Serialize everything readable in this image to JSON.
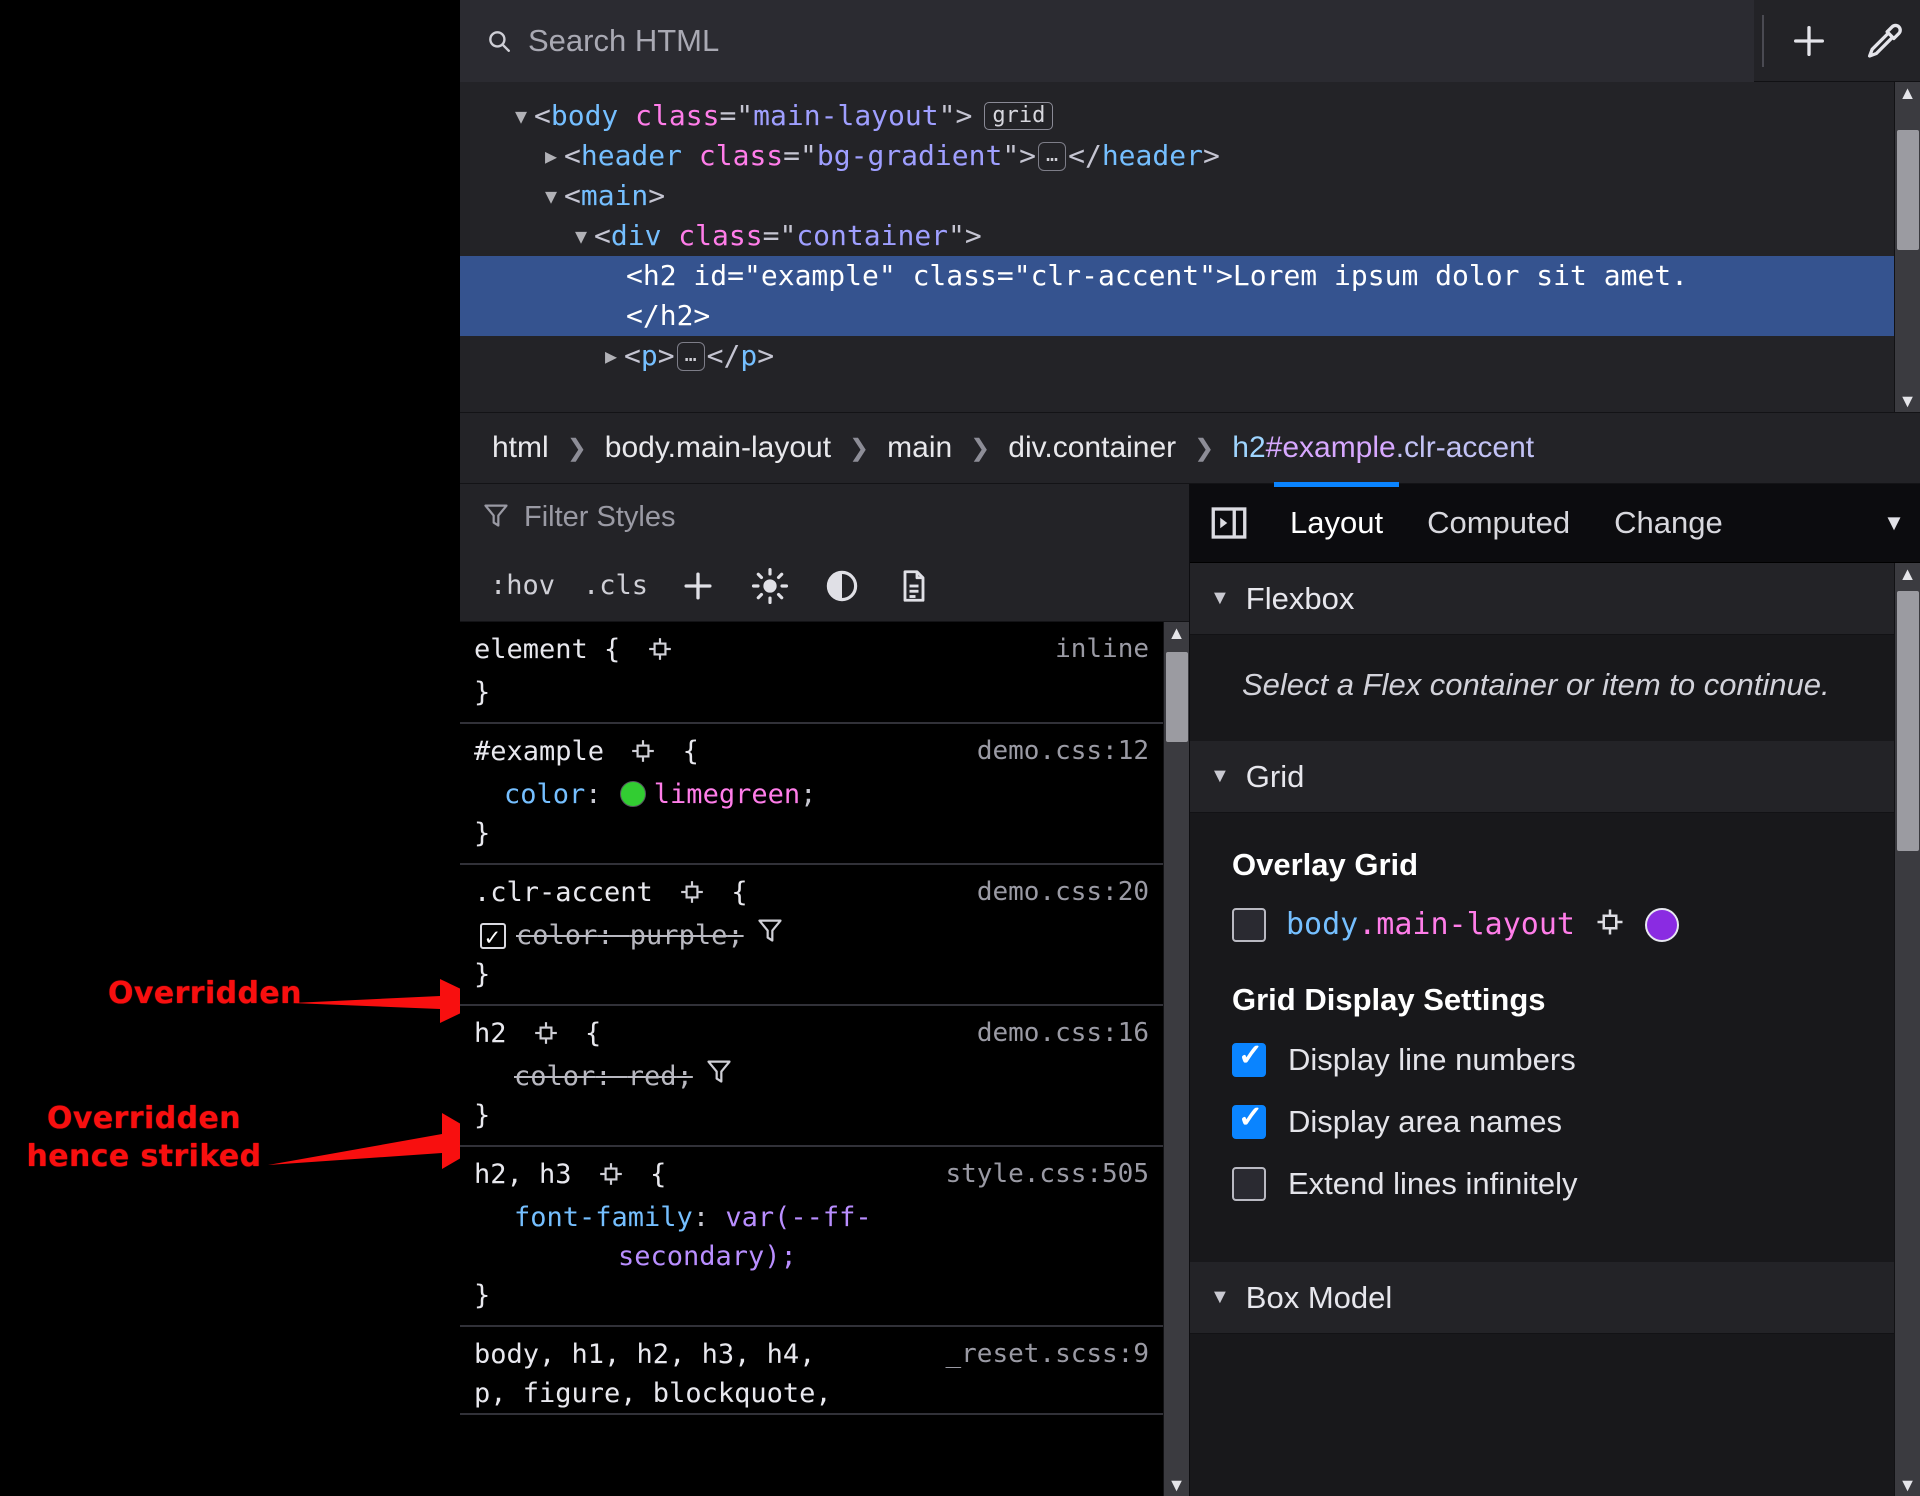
{
  "toolbar": {
    "search_placeholder": "Search HTML",
    "search_value": "",
    "search_icon": "search-icon",
    "add_node_label": "+",
    "eyedropper_icon": "eyedropper-icon"
  },
  "markup": {
    "nodes": [
      {
        "indent": 1,
        "twisty": "▼",
        "parts": [
          {
            "t": "punc",
            "v": "<"
          },
          {
            "t": "tag",
            "v": "body"
          },
          {
            "t": "punc",
            "v": " "
          },
          {
            "t": "attr",
            "v": "class"
          },
          {
            "t": "punc",
            "v": "=\""
          },
          {
            "t": "val",
            "v": "main-layout"
          },
          {
            "t": "punc",
            "v": "\">"
          }
        ],
        "badge": "grid"
      },
      {
        "indent": 2,
        "twisty": "▶",
        "parts": [
          {
            "t": "punc",
            "v": "<"
          },
          {
            "t": "tag",
            "v": "header"
          },
          {
            "t": "punc",
            "v": " "
          },
          {
            "t": "attr",
            "v": "class"
          },
          {
            "t": "punc",
            "v": "=\""
          },
          {
            "t": "val",
            "v": "bg-gradient"
          },
          {
            "t": "punc",
            "v": ">"
          }
        ],
        "ellipsis": true,
        "tail": [
          {
            "t": "punc",
            "v": "</"
          },
          {
            "t": "tag",
            "v": "header"
          },
          {
            "t": "punc",
            "v": ">"
          }
        ]
      },
      {
        "indent": 2,
        "twisty": "▼",
        "parts": [
          {
            "t": "punc",
            "v": "<"
          },
          {
            "t": "tag",
            "v": "main"
          },
          {
            "t": "punc",
            "v": ">"
          }
        ]
      },
      {
        "indent": 3,
        "twisty": "▼",
        "parts": [
          {
            "t": "punc",
            "v": "<"
          },
          {
            "t": "tag",
            "v": "div"
          },
          {
            "t": "punc",
            "v": " "
          },
          {
            "t": "attr",
            "v": "class"
          },
          {
            "t": "punc",
            "v": "=\""
          },
          {
            "t": "val",
            "v": "container"
          },
          {
            "t": "punc",
            "v": "\">"
          }
        ]
      }
    ],
    "selected": {
      "indent": 4,
      "line1": "<h2 id=\"example\" class=\"clr-accent\">Lorem ipsum dolor sit amet.",
      "line2": "</h2>"
    },
    "after": [
      {
        "indent": 3,
        "twisty": "▶",
        "parts": [
          {
            "t": "punc",
            "v": "<"
          },
          {
            "t": "tag",
            "v": "p"
          },
          {
            "t": "punc",
            "v": ">"
          }
        ],
        "ellipsis": true,
        "tail": [
          {
            "t": "punc",
            "v": "</"
          },
          {
            "t": "tag",
            "v": "p"
          },
          {
            "t": "punc",
            "v": ">"
          }
        ]
      }
    ]
  },
  "breadcrumbs": [
    {
      "text": "html",
      "selected": false
    },
    {
      "text": "body.main-layout",
      "selected": false
    },
    {
      "text": "main",
      "selected": false
    },
    {
      "text": "div.container",
      "selected": false
    },
    {
      "tag": "h2",
      "id": "#example",
      "cls": ".clr-accent",
      "selected": true
    }
  ],
  "breadcrumb_separator": "❯",
  "styles": {
    "filter_placeholder": "Filter Styles",
    "filter_value": "",
    "filter_icon": "funnel-icon",
    "buttons": [
      {
        "label": ":hov",
        "name": "pseudo-class-button"
      },
      {
        "label": ".cls",
        "name": "class-panel-button"
      },
      {
        "label": "+",
        "name": "add-rule-button"
      },
      {
        "label": "",
        "name": "light-scheme-icon"
      },
      {
        "label": "",
        "name": "dark-scheme-icon"
      },
      {
        "label": "",
        "name": "print-media-icon"
      }
    ],
    "rules": [
      {
        "selector": "element",
        "source": "inline",
        "has_target_icon": true,
        "declarations": []
      },
      {
        "selector": "#example",
        "source": "demo.css:12",
        "has_target_icon": true,
        "declarations": [
          {
            "property": "color",
            "value": "limegreen",
            "swatch": "#32cd32",
            "struck": false,
            "checkbox": false,
            "warning": false
          }
        ]
      },
      {
        "selector": ".clr-accent",
        "source": "demo.css:20",
        "has_target_icon": true,
        "declarations": [
          {
            "property": "color",
            "value": "purple",
            "swatch": null,
            "struck": true,
            "checkbox": true,
            "warning": true
          }
        ]
      },
      {
        "selector": "h2",
        "source": "demo.css:16",
        "has_target_icon": true,
        "declarations": [
          {
            "property": "color",
            "value": "red",
            "swatch": null,
            "struck": true,
            "checkbox": false,
            "warning": true
          }
        ]
      },
      {
        "selector": "h2, h3",
        "source": "style.css:505",
        "has_target_icon": true,
        "declarations": [
          {
            "property": "font-family",
            "value": "var(--ff-secondary);",
            "value_line1": "var(--ff-",
            "value_line2": "secondary);",
            "swatch": null,
            "struck": false,
            "checkbox": false,
            "warning": false
          }
        ]
      },
      {
        "selector_line1": "body, h1, h2, h3, h4,",
        "selector_line2": "p, figure, blockquote,",
        "source": "_reset.scss:9",
        "has_target_icon": false,
        "declarations": []
      }
    ]
  },
  "layout": {
    "tabs": [
      {
        "label": "Layout",
        "active": true
      },
      {
        "label": "Computed",
        "active": false
      },
      {
        "label": "Change",
        "active": false
      }
    ],
    "tabs_overflow_icon": "chevron-down-icon",
    "panel_toggle_icon": "expand-panel-icon",
    "flexbox": {
      "title": "Flexbox",
      "hint": "Select a Flex container or item to continue."
    },
    "grid": {
      "title": "Grid",
      "overlay_title": "Overlay Grid",
      "overlay_item": {
        "checked": false,
        "tag": "body",
        "cls": ".main-layout",
        "color": "#8a2be2"
      },
      "settings_title": "Grid Display Settings",
      "settings": [
        {
          "label": "Display line numbers",
          "checked": true
        },
        {
          "label": "Display area names",
          "checked": true
        },
        {
          "label": "Extend lines infinitely",
          "checked": false
        }
      ]
    },
    "box_model": {
      "title": "Box Model"
    }
  },
  "annotations": [
    {
      "text": "Overridden",
      "color": "#f80f0f"
    },
    {
      "text": "Overridden\nhence striked",
      "color": "#f80f0f"
    }
  ]
}
